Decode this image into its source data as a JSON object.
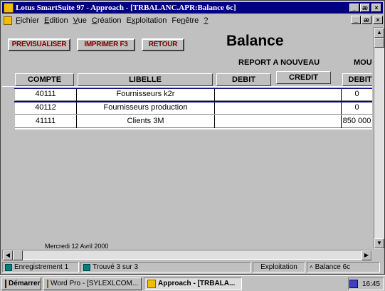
{
  "window": {
    "title": "Lotus SmartSuite 97  - Approach - [TRBALANC.APR:Balance 6c]",
    "buttons": {
      "minimize": "_",
      "maximize": "æ",
      "close": "×"
    }
  },
  "menu": {
    "items": [
      {
        "underline": "F",
        "rest": "ichier"
      },
      {
        "underline": "E",
        "rest": "dition"
      },
      {
        "underline": "V",
        "rest": "ue"
      },
      {
        "underline": "C",
        "rest": "réation"
      },
      {
        "underline": "x",
        "pre": "E",
        "rest": "ploitation"
      },
      {
        "underline": "n",
        "pre": "Fe",
        "rest": "être"
      },
      {
        "underline": "?",
        "rest": ""
      }
    ]
  },
  "form": {
    "buttons": {
      "preview": "PREVISUALISER",
      "print": "IMPRIMER F3",
      "back": "RETOUR"
    },
    "title": "Balance",
    "report_heading": "REPORT A NOUVEAU",
    "mouv_heading": "MOUV",
    "columns": {
      "compte": "COMPTE",
      "libelle": "LIBELLE",
      "debit": "DEBIT",
      "credit": "CREDIT",
      "mouv_debit": "DEBIT"
    },
    "rows": [
      {
        "compte": "40111",
        "libelle": "Fournisseurs k2r",
        "debit": "",
        "credit": "",
        "mouv_debit": "0"
      },
      {
        "compte": "40112",
        "libelle": "Fournisseurs production",
        "debit": "",
        "credit": "",
        "mouv_debit": "0"
      },
      {
        "compte": "41111",
        "libelle": "Clients 3M",
        "debit": "",
        "credit": "",
        "mouv_debit": "850 000"
      }
    ],
    "footer_date": "Mercredi 12 Avril 2000"
  },
  "status": {
    "record": "Enregistrement 1",
    "found": "Trouvé 3 sur 3",
    "mode": "Exploitation",
    "view": "Balance 6c"
  },
  "taskbar": {
    "start": "Démarrer",
    "tasks": [
      {
        "label": "Word Pro - [SYLEXLCOM...",
        "active": false
      },
      {
        "label": "Approach - [TRBALA...",
        "active": true
      }
    ],
    "clock": "16:45"
  },
  "colors": {
    "titlebar": "#000080",
    "button_text": "#800000",
    "selection": "#000080"
  }
}
